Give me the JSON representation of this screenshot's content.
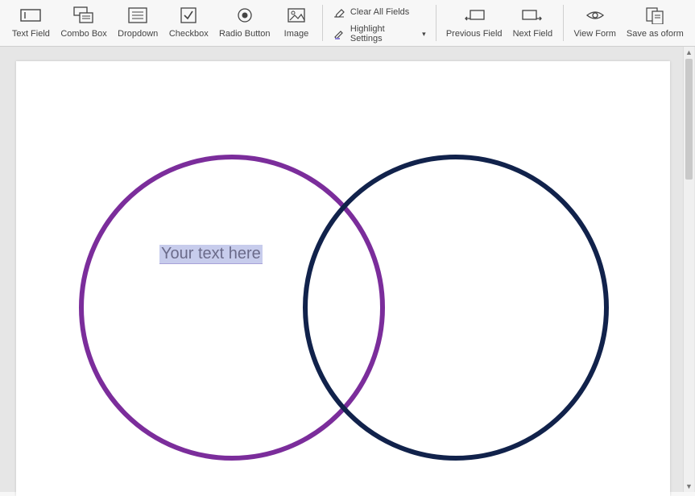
{
  "toolbar": {
    "text_field": "Text Field",
    "combo_box": "Combo Box",
    "dropdown": "Dropdown",
    "checkbox": "Checkbox",
    "radio_button": "Radio Button",
    "image": "Image",
    "clear_all_fields": "Clear All Fields",
    "highlight_settings": "Highlight Settings",
    "previous_field": "Previous Field",
    "next_field": "Next Field",
    "view_form": "View Form",
    "save_as_oform": "Save as oform"
  },
  "canvas": {
    "field_placeholder": "Your text here"
  }
}
